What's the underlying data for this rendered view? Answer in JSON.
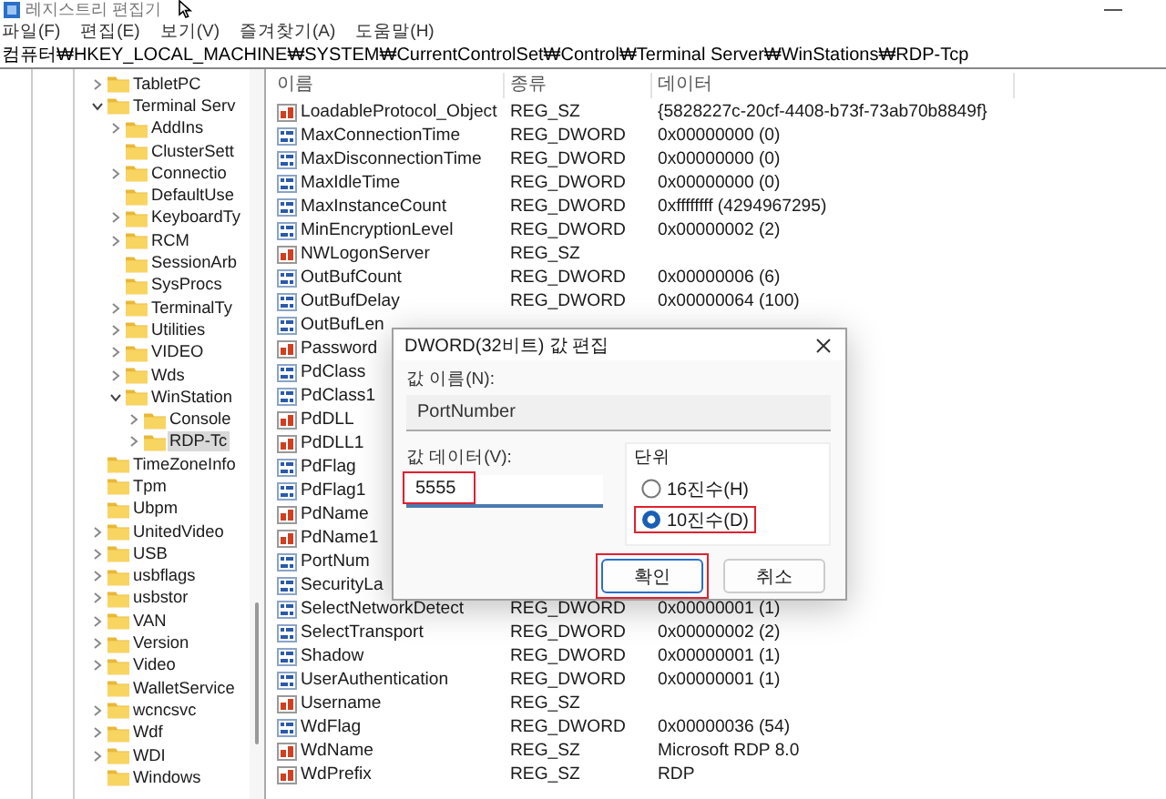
{
  "window": {
    "title": "레지스트리 편집기"
  },
  "menu": [
    "파일(F)",
    "편집(E)",
    "보기(V)",
    "즐겨찾기(A)",
    "도움말(H)"
  ],
  "address": "컴퓨터₩HKEY_LOCAL_MACHINE₩SYSTEM₩CurrentControlSet₩Control₩Terminal Server₩WinStations₩RDP-Tcp",
  "tree": [
    {
      "label": "TabletPC",
      "expandable": true,
      "selected": false
    },
    {
      "label": "Terminal Serv",
      "expandable": true,
      "expanded": true,
      "selected": false,
      "children": [
        {
          "label": "AddIns",
          "expandable": true,
          "selected": false
        },
        {
          "label": "ClusterSett",
          "expandable": false,
          "selected": false
        },
        {
          "label": "Connectio",
          "expandable": true,
          "selected": false
        },
        {
          "label": "DefaultUse",
          "expandable": false,
          "selected": false
        },
        {
          "label": "KeyboardTy",
          "expandable": true,
          "selected": false
        },
        {
          "label": "RCM",
          "expandable": true,
          "selected": false
        },
        {
          "label": "SessionArb",
          "expandable": false,
          "selected": false
        },
        {
          "label": "SysProcs",
          "expandable": false,
          "selected": false
        },
        {
          "label": "TerminalTy",
          "expandable": true,
          "selected": false
        },
        {
          "label": "Utilities",
          "expandable": true,
          "selected": false
        },
        {
          "label": "VIDEO",
          "expandable": true,
          "selected": false
        },
        {
          "label": "Wds",
          "expandable": true,
          "selected": false
        },
        {
          "label": "WinStation",
          "expandable": true,
          "expanded": true,
          "selected": false,
          "children": [
            {
              "label": "Console",
              "expandable": true,
              "selected": false
            },
            {
              "label": "RDP-Tc",
              "expandable": true,
              "selected": true
            }
          ]
        }
      ]
    },
    {
      "label": "TimeZoneInfo",
      "expandable": false,
      "selected": false
    },
    {
      "label": "Tpm",
      "expandable": false,
      "selected": false
    },
    {
      "label": "Ubpm",
      "expandable": false,
      "selected": false
    },
    {
      "label": "UnitedVideo",
      "expandable": true,
      "selected": false
    },
    {
      "label": "USB",
      "expandable": true,
      "selected": false
    },
    {
      "label": "usbflags",
      "expandable": true,
      "selected": false
    },
    {
      "label": "usbstor",
      "expandable": true,
      "selected": false
    },
    {
      "label": "VAN",
      "expandable": true,
      "selected": false
    },
    {
      "label": "Version",
      "expandable": true,
      "selected": false
    },
    {
      "label": "Video",
      "expandable": true,
      "selected": false
    },
    {
      "label": "WalletService",
      "expandable": false,
      "selected": false
    },
    {
      "label": "wcncsvc",
      "expandable": true,
      "selected": false
    },
    {
      "label": "Wdf",
      "expandable": true,
      "selected": false
    },
    {
      "label": "WDI",
      "expandable": true,
      "selected": false
    },
    {
      "label": "Windows",
      "expandable": false,
      "selected": false
    }
  ],
  "table": {
    "columns": [
      "이름",
      "종류",
      "데이터"
    ],
    "rows": [
      {
        "kind": "string",
        "name": "LoadableProtocol_Object",
        "type": "REG_SZ",
        "data": "{5828227c-20cf-4408-b73f-73ab70b8849f}"
      },
      {
        "kind": "binary",
        "name": "MaxConnectionTime",
        "type": "REG_DWORD",
        "data": "0x00000000 (0)"
      },
      {
        "kind": "binary",
        "name": "MaxDisconnectionTime",
        "type": "REG_DWORD",
        "data": "0x00000000 (0)"
      },
      {
        "kind": "binary",
        "name": "MaxIdleTime",
        "type": "REG_DWORD",
        "data": "0x00000000 (0)"
      },
      {
        "kind": "binary",
        "name": "MaxInstanceCount",
        "type": "REG_DWORD",
        "data": "0xffffffff (4294967295)"
      },
      {
        "kind": "binary",
        "name": "MinEncryptionLevel",
        "type": "REG_DWORD",
        "data": "0x00000002 (2)"
      },
      {
        "kind": "string",
        "name": "NWLogonServer",
        "type": "REG_SZ"
      },
      {
        "kind": "binary",
        "name": "OutBufCount",
        "type": "REG_DWORD",
        "data": "0x00000006 (6)"
      },
      {
        "kind": "binary",
        "name": "OutBufDelay",
        "type": "REG_DWORD",
        "data": "0x00000064 (100)"
      },
      {
        "kind": "binary",
        "name": "OutBufLen"
      },
      {
        "kind": "string",
        "name": "Password"
      },
      {
        "kind": "binary",
        "name": "PdClass"
      },
      {
        "kind": "binary",
        "name": "PdClass1"
      },
      {
        "kind": "string",
        "name": "PdDLL"
      },
      {
        "kind": "string",
        "name": "PdDLL1"
      },
      {
        "kind": "binary",
        "name": "PdFlag"
      },
      {
        "kind": "binary",
        "name": "PdFlag1"
      },
      {
        "kind": "string",
        "name": "PdName"
      },
      {
        "kind": "string",
        "name": "PdName1"
      },
      {
        "kind": "binary",
        "name": "PortNum"
      },
      {
        "kind": "binary",
        "name": "SecurityLa"
      },
      {
        "kind": "binary",
        "name": "SelectNetworkDetect",
        "type": "REG_DWORD",
        "data": "0x00000001 (1)"
      },
      {
        "kind": "binary",
        "name": "SelectTransport",
        "type": "REG_DWORD",
        "data": "0x00000002 (2)"
      },
      {
        "kind": "binary",
        "name": "Shadow",
        "type": "REG_DWORD",
        "data": "0x00000001 (1)"
      },
      {
        "kind": "binary",
        "name": "UserAuthentication",
        "type": "REG_DWORD",
        "data": "0x00000001 (1)"
      },
      {
        "kind": "string",
        "name": "Username",
        "type": "REG_SZ"
      },
      {
        "kind": "binary",
        "name": "WdFlag",
        "type": "REG_DWORD",
        "data": "0x00000036 (54)"
      },
      {
        "kind": "string",
        "name": "WdName",
        "type": "REG_SZ",
        "data": "Microsoft RDP 8.0"
      },
      {
        "kind": "string",
        "name": "WdPrefix",
        "type": "REG_SZ",
        "data": "RDP"
      }
    ]
  },
  "dialog": {
    "title": "DWORD(32비트) 값 편집",
    "name_label": "값 이름(N):",
    "name_value": "PortNumber",
    "data_label": "값 데이터(V):",
    "data_value": "5555",
    "data_highlighted": true,
    "base_label": "단위",
    "bases": [
      {
        "label": "16진수(H)",
        "selected": false,
        "highlighted": false
      },
      {
        "label": "10진수(D)",
        "selected": true,
        "highlighted": true
      }
    ],
    "buttons": [
      {
        "label": "확인",
        "default": true,
        "highlighted": true
      },
      {
        "label": "취소",
        "default": false,
        "highlighted": false
      }
    ]
  }
}
